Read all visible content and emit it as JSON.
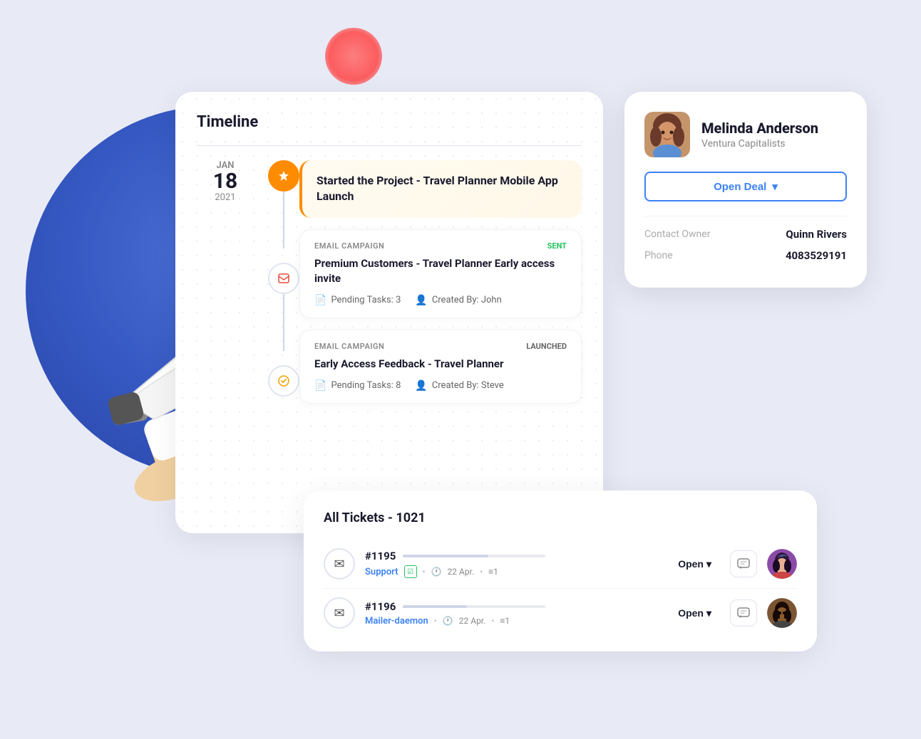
{
  "page": {
    "background": "#e8eaf6"
  },
  "timeline": {
    "title": "Timeline",
    "date": {
      "month": "JAN",
      "day": "18",
      "year": "2021"
    },
    "items": [
      {
        "type": "project",
        "title": "Started the Project - Travel Planner Mobile App Launch"
      },
      {
        "type": "email_campaign",
        "campaign_type": "EMAIL CAMPAIGN",
        "status": "SENT",
        "status_color": "green",
        "title": "Premium Customers - Travel Planner Early access invite",
        "pending_tasks": "Pending Tasks: 3",
        "created_by": "Created By: John"
      },
      {
        "type": "email_campaign",
        "campaign_type": "EMAIL CAMPAIGN",
        "status": "LAUNCHED",
        "status_color": "gray",
        "title": "Early Access Feedback - Travel Planner",
        "pending_tasks": "Pending Tasks: 8",
        "created_by": "Created By: Steve"
      }
    ]
  },
  "contact": {
    "name": "Melinda Anderson",
    "company": "Ventura Capitalists",
    "open_deal_label": "Open Deal",
    "fields": [
      {
        "label": "Contact Owner",
        "value": "Quinn Rivers"
      },
      {
        "label": "Phone",
        "value": "4083529191"
      }
    ]
  },
  "tickets": {
    "title": "All Tickets - 1021",
    "items": [
      {
        "number": "#1195",
        "tag": "Support",
        "date": "22 Apr.",
        "count": "≡1",
        "status": "Open"
      },
      {
        "number": "#1196",
        "tag": "Mailer-daemon",
        "date": "22 Apr.",
        "count": "≡1",
        "status": "Open"
      }
    ]
  },
  "icons": {
    "flag": "⚑",
    "email_campaign_1": "📋",
    "email_campaign_2": "✓",
    "chevron_down": "▾",
    "tasks": "📄",
    "person": "👤",
    "clock": "🕐",
    "list": "≡",
    "chat": "💬",
    "envelope": "✉"
  }
}
